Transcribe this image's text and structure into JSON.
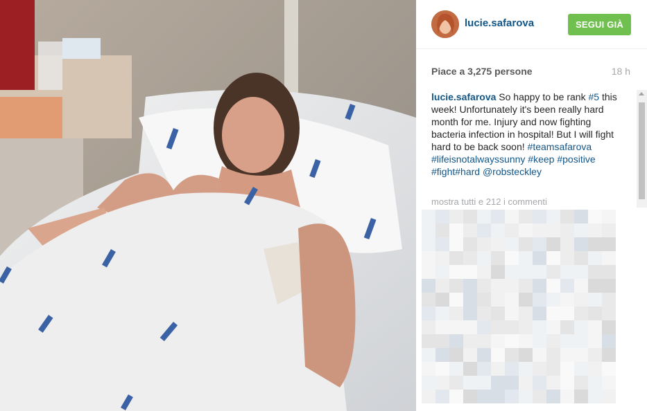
{
  "post": {
    "username": "lucie.safarova",
    "follow_label": "SEGUI GIÀ",
    "likes": "Piace a 3,275 persone",
    "time": "18 h",
    "caption": {
      "user": "lucie.safarova",
      "t1": " So happy to be rank ",
      "tag_rank": "#5",
      "t2": " this week! Unfortunately it's been really hard month for me. Injury and now fighting bacteria infection in hospital! But I will fight hard to be back soon! ",
      "tag1": "#teamsafarova",
      "tag2": "#lifeisnotalwayssunny",
      "tag3": "#keep",
      "tag4": "#positive",
      "tag5": "#fight",
      "tag6": "#hard",
      "mention": "@robsteckley"
    },
    "show_comments": "mostra tutti e 212 i commenti"
  },
  "colors": {
    "link": "#125688",
    "follow_bg": "#70c050",
    "muted": "#a5a7aa"
  }
}
